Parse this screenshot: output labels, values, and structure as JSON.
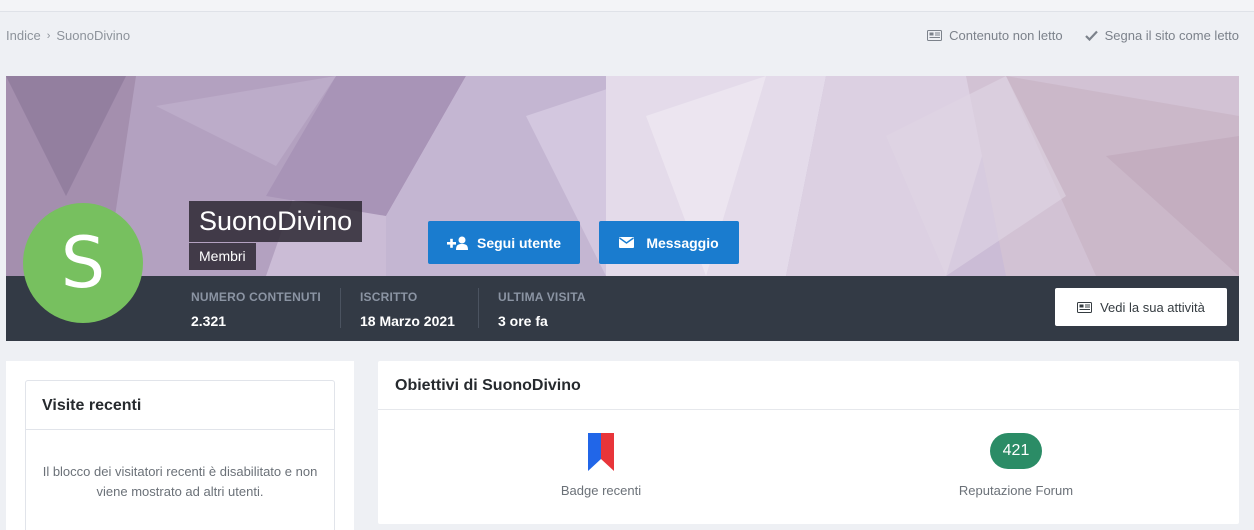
{
  "breadcrumb": {
    "home": "Indice",
    "current": "SuonoDivino"
  },
  "top_actions": {
    "unread": "Contenuto non letto",
    "mark_read": "Segna il sito come letto"
  },
  "profile": {
    "avatar_letter": "S",
    "avatar_color": "#77c05f",
    "username": "SuonoDivino",
    "group": "Membri",
    "follow_label": "Segui utente",
    "message_label": "Messaggio",
    "activity_label": "Vedi la sua attività",
    "accent_color": "#1a7ccf"
  },
  "stats": [
    {
      "label": "NUMERO CONTENUTI",
      "value": "2.321"
    },
    {
      "label": "ISCRITTO",
      "value": "18 Marzo 2021"
    },
    {
      "label": "ULTIMA VISITA",
      "value": "3 ore fa"
    }
  ],
  "recent_visits": {
    "title": "Visite recenti",
    "message": "Il blocco dei visitatori recenti è disabilitato e non viene mostrato ad altri utenti."
  },
  "achievements": {
    "title": "Obiettivi di SuonoDivino",
    "badge_caption": "Badge recenti",
    "reputation_value": "421",
    "reputation_caption": "Reputazione Forum",
    "reputation_color": "#2b8c66"
  }
}
